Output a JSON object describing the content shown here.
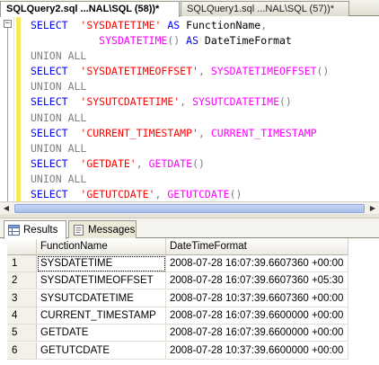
{
  "tabs": [
    {
      "label": "SQLQuery2.sql ...NAL\\SQL (58))*",
      "active": true
    },
    {
      "label": "SQLQuery1.sql ...NAL\\SQL (57))*",
      "active": false
    }
  ],
  "editor": {
    "collapse_glyph": "−",
    "lines": [
      [
        {
          "t": "kw",
          "v": "SELECT"
        },
        {
          "t": "id",
          "v": "  "
        },
        {
          "t": "str",
          "v": "'SYSDATETIME'"
        },
        {
          "t": "id",
          "v": " "
        },
        {
          "t": "kw",
          "v": "AS"
        },
        {
          "t": "id",
          "v": " FunctionName"
        },
        {
          "t": "op",
          "v": ","
        }
      ],
      [
        {
          "t": "id",
          "v": "           "
        },
        {
          "t": "fn",
          "v": "SYSDATETIME"
        },
        {
          "t": "op",
          "v": "()"
        },
        {
          "t": "id",
          "v": " "
        },
        {
          "t": "kw",
          "v": "AS"
        },
        {
          "t": "id",
          "v": " DateTimeFormat"
        }
      ],
      [
        {
          "t": "op",
          "v": "UNION"
        },
        {
          "t": "id",
          "v": " "
        },
        {
          "t": "op",
          "v": "ALL"
        }
      ],
      [
        {
          "t": "kw",
          "v": "SELECT"
        },
        {
          "t": "id",
          "v": "  "
        },
        {
          "t": "str",
          "v": "'SYSDATETIMEOFFSET'"
        },
        {
          "t": "op",
          "v": ","
        },
        {
          "t": "id",
          "v": " "
        },
        {
          "t": "fn",
          "v": "SYSDATETIMEOFFSET"
        },
        {
          "t": "op",
          "v": "()"
        }
      ],
      [
        {
          "t": "op",
          "v": "UNION"
        },
        {
          "t": "id",
          "v": " "
        },
        {
          "t": "op",
          "v": "ALL"
        }
      ],
      [
        {
          "t": "kw",
          "v": "SELECT"
        },
        {
          "t": "id",
          "v": "  "
        },
        {
          "t": "str",
          "v": "'SYSUTCDATETIME'"
        },
        {
          "t": "op",
          "v": ","
        },
        {
          "t": "id",
          "v": " "
        },
        {
          "t": "fn",
          "v": "SYSUTCDATETIME"
        },
        {
          "t": "op",
          "v": "()"
        }
      ],
      [
        {
          "t": "op",
          "v": "UNION"
        },
        {
          "t": "id",
          "v": " "
        },
        {
          "t": "op",
          "v": "ALL"
        }
      ],
      [
        {
          "t": "kw",
          "v": "SELECT"
        },
        {
          "t": "id",
          "v": "  "
        },
        {
          "t": "str",
          "v": "'CURRENT_TIMESTAMP'"
        },
        {
          "t": "op",
          "v": ","
        },
        {
          "t": "id",
          "v": " "
        },
        {
          "t": "fn",
          "v": "CURRENT_TIMESTAMP"
        }
      ],
      [
        {
          "t": "op",
          "v": "UNION"
        },
        {
          "t": "id",
          "v": " "
        },
        {
          "t": "op",
          "v": "ALL"
        }
      ],
      [
        {
          "t": "kw",
          "v": "SELECT"
        },
        {
          "t": "id",
          "v": "  "
        },
        {
          "t": "str",
          "v": "'GETDATE'"
        },
        {
          "t": "op",
          "v": ","
        },
        {
          "t": "id",
          "v": " "
        },
        {
          "t": "fn",
          "v": "GETDATE"
        },
        {
          "t": "op",
          "v": "()"
        }
      ],
      [
        {
          "t": "op",
          "v": "UNION"
        },
        {
          "t": "id",
          "v": " "
        },
        {
          "t": "op",
          "v": "ALL"
        }
      ],
      [
        {
          "t": "kw",
          "v": "SELECT"
        },
        {
          "t": "id",
          "v": "  "
        },
        {
          "t": "str",
          "v": "'GETUTCDATE'"
        },
        {
          "t": "op",
          "v": ","
        },
        {
          "t": "id",
          "v": " "
        },
        {
          "t": "fn",
          "v": "GETUTCDATE"
        },
        {
          "t": "op",
          "v": "()"
        }
      ]
    ]
  },
  "scrollbar": {
    "left_arrow": "◀",
    "right_arrow": "▶"
  },
  "results_tabs": [
    {
      "label": "Results",
      "icon": "grid-icon",
      "active": true
    },
    {
      "label": "Messages",
      "icon": "messages-icon",
      "active": false
    }
  ],
  "grid": {
    "columns": [
      "FunctionName",
      "DateTimeFormat"
    ],
    "rows": [
      {
        "num": "1",
        "cells": [
          "SYSDATETIME",
          "2008-07-28 16:07:39.6607360 +00:00"
        ]
      },
      {
        "num": "2",
        "cells": [
          "SYSDATETIMEOFFSET",
          "2008-07-28 16:07:39.6607360 +05:30"
        ]
      },
      {
        "num": "3",
        "cells": [
          "SYSUTCDATETIME",
          "2008-07-28 10:37:39.6607360 +00:00"
        ]
      },
      {
        "num": "4",
        "cells": [
          "CURRENT_TIMESTAMP",
          "2008-07-28 16:07:39.6600000 +00:00"
        ]
      },
      {
        "num": "5",
        "cells": [
          "GETDATE",
          "2008-07-28 16:07:39.6600000 +00:00"
        ]
      },
      {
        "num": "6",
        "cells": [
          "GETUTCDATE",
          "2008-07-28 10:37:39.6600000 +00:00"
        ]
      }
    ]
  },
  "colors": {
    "keyword": "#0000ff",
    "string": "#ff0000",
    "function": "#ff00ff",
    "operator": "#808080",
    "change_bar": "#f6e85a"
  }
}
